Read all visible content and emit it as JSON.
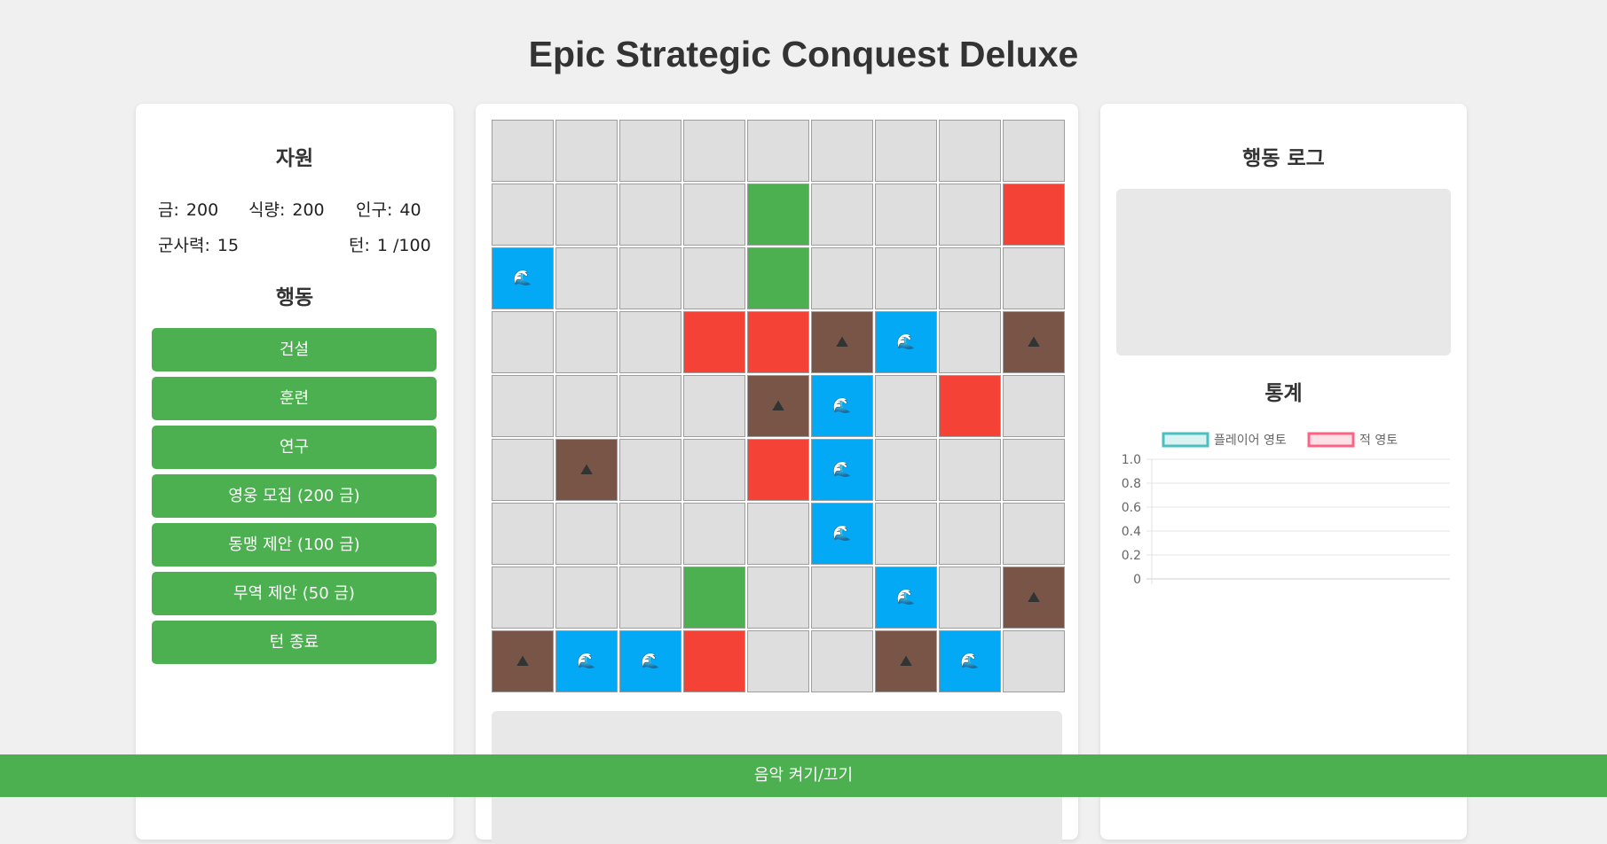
{
  "title": "Epic Strategic Conquest Deluxe",
  "resources": {
    "heading": "자원",
    "gold_label": "금",
    "gold": "200",
    "food_label": "식량",
    "food": "200",
    "population_label": "인구",
    "population": "40",
    "military_label": "군사력",
    "military": "15",
    "turn_label": "턴",
    "turn": "1 /100"
  },
  "actions": {
    "heading": "행동",
    "buttons": [
      "건설",
      "훈련",
      "연구",
      "영웅 모집 (200 금)",
      "동맹 제안 (100 금)",
      "무역 제안 (50 금)",
      "턴 종료"
    ]
  },
  "map": {
    "legend": {
      "empty": "#dedede",
      "player": "#4caf50",
      "enemy": "#f44336",
      "water": "#03a9f4",
      "mountain": "#795548"
    },
    "icons": {
      "water": "wave-icon",
      "mountain": "mountain-icon"
    },
    "glyphs": {
      "water": "🌊",
      "mountain": "⛰"
    },
    "rows": [
      [
        "empty",
        "empty",
        "empty",
        "empty",
        "empty",
        "empty",
        "empty",
        "empty",
        "empty"
      ],
      [
        "empty",
        "empty",
        "empty",
        "empty",
        "player",
        "empty",
        "empty",
        "empty",
        "enemy"
      ],
      [
        "water",
        "empty",
        "empty",
        "empty",
        "player",
        "empty",
        "empty",
        "empty",
        "empty"
      ],
      [
        "empty",
        "empty",
        "empty",
        "enemy",
        "enemy",
        "mountain",
        "water",
        "empty",
        "mountain"
      ],
      [
        "empty",
        "empty",
        "empty",
        "empty",
        "mountain",
        "water",
        "empty",
        "enemy",
        "empty"
      ],
      [
        "empty",
        "mountain",
        "empty",
        "empty",
        "enemy",
        "water",
        "empty",
        "empty",
        "empty"
      ],
      [
        "empty",
        "empty",
        "empty",
        "empty",
        "empty",
        "water",
        "empty",
        "empty",
        "empty"
      ],
      [
        "empty",
        "empty",
        "empty",
        "player",
        "empty",
        "empty",
        "water",
        "empty",
        "mountain"
      ],
      [
        "mountain",
        "water",
        "water",
        "enemy",
        "empty",
        "empty",
        "mountain",
        "water",
        "empty"
      ]
    ]
  },
  "log": {
    "heading": "행동 로그"
  },
  "stats": {
    "heading": "통계"
  },
  "chart_data": {
    "type": "line",
    "series": [
      {
        "name": "플레이어 영토",
        "values": [],
        "color": "#4bc0c0"
      },
      {
        "name": "적 영토",
        "values": [],
        "color": "#ff6384"
      }
    ],
    "ylim": [
      0,
      1.0
    ],
    "yticks": [
      "1.0",
      "0.8",
      "0.6",
      "0.4",
      "0.2",
      "0"
    ],
    "legend": "top",
    "grid": true
  },
  "music_toggle": "음악 켜기/끄기"
}
